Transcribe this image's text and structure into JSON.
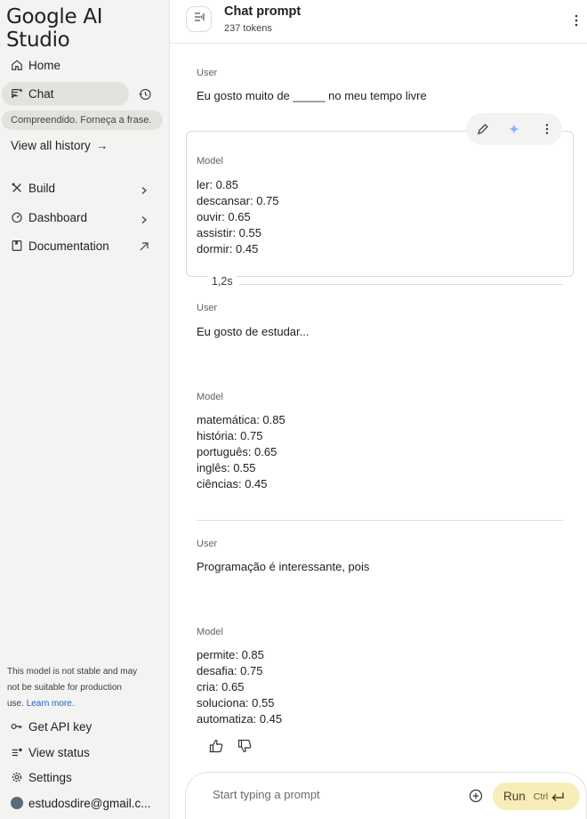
{
  "sidebar": {
    "logo": "Google AI Studio",
    "nav": {
      "home": "Home",
      "chat": "Chat",
      "recent_chat": "Compreendido. Forneça a frase.",
      "view_all_history": "View all history",
      "view_all_arrow": "→",
      "build": "Build",
      "dashboard": "Dashboard",
      "documentation": "Documentation"
    },
    "disclaimer": {
      "text": "This model is not stable and may not be suitable for production use.",
      "link": "Learn more."
    },
    "footer": {
      "get_api_key": "Get API key",
      "view_status": "View status",
      "settings": "Settings",
      "account": "estudosdire@gmail.c..."
    }
  },
  "header": {
    "title": "Chat prompt",
    "tokens": "237 tokens"
  },
  "chat": {
    "turns": [
      {
        "user_role": "User",
        "user_text": "Eu gosto muito de _____ no meu tempo livre",
        "model_role": "Model",
        "model_lines": [
          "ler: 0.85",
          "descansar: 0.75",
          "ouvir: 0.65",
          "assistir: 0.55",
          "dormir: 0.45"
        ],
        "timing": "1,2s"
      },
      {
        "user_role": "User",
        "user_text": "Eu gosto de estudar...",
        "model_role": "Model",
        "model_lines": [
          "matemática: 0.85",
          "história: 0.75",
          "português: 0.65",
          "inglês: 0.55",
          "ciências: 0.45"
        ]
      },
      {
        "user_role": "User",
        "user_text": "Programação é interessante, pois",
        "model_role": "Model",
        "model_lines": [
          "permite: 0.85",
          "desafia: 0.75",
          "cria: 0.65",
          "soluciona: 0.55",
          "automatiza: 0.45"
        ]
      }
    ]
  },
  "prompt": {
    "placeholder": "Start typing a prompt",
    "run_label": "Run",
    "run_shortcut": "Ctrl"
  },
  "colors": {
    "sidebar_bg": "#f3f3f1",
    "active_pill": "#e2e2df",
    "run_button": "#f7edb8",
    "link": "#1a63c8",
    "sparkle_accent": "#8ab4f8"
  },
  "icons": {
    "home": "home-icon",
    "chat": "chat-icon",
    "history": "history-icon",
    "build": "build-icon",
    "dashboard": "dashboard-icon",
    "documentation": "book-icon",
    "external": "external-link-icon",
    "key": "key-icon",
    "status": "status-icon",
    "settings": "gear-icon",
    "edit": "pencil-icon",
    "rerun": "sparkle-icon",
    "more": "kebab-icon",
    "thumbs_up": "thumbs-up-icon",
    "thumbs_down": "thumbs-down-icon",
    "add": "add-circle-icon",
    "enter": "enter-key-icon"
  }
}
